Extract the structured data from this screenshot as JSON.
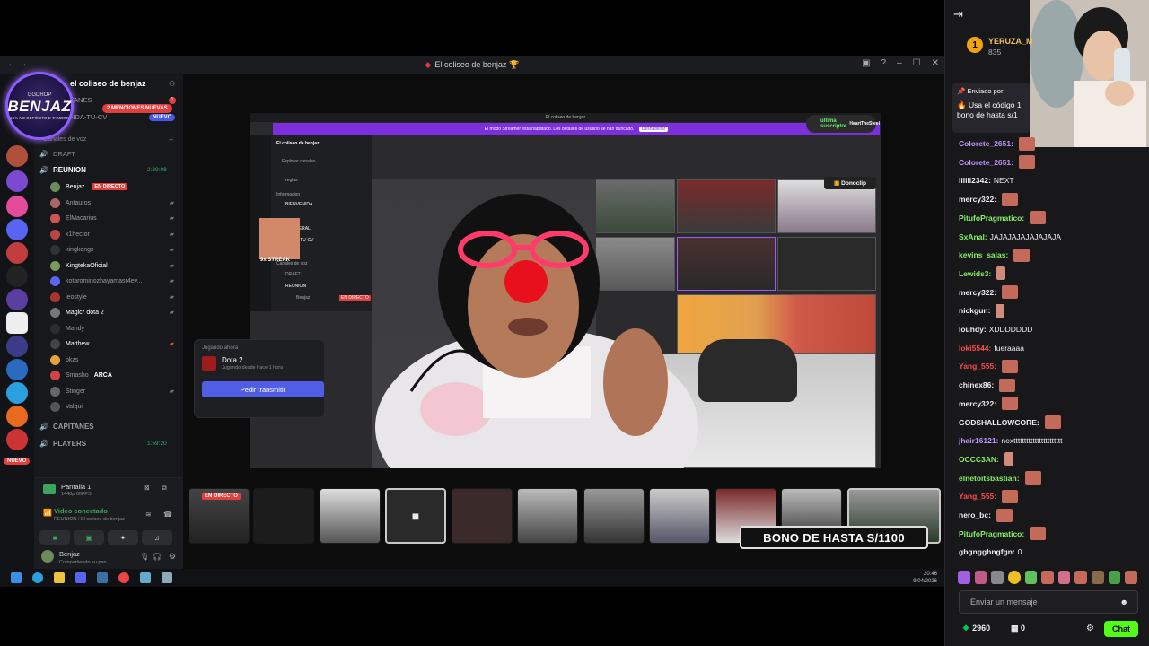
{
  "window": {
    "title": "El coliseo de benjaz",
    "title_emoji": "🏆"
  },
  "logo": {
    "brand": "GGDROP",
    "name": "BENJAZ",
    "tagline": "15% NO DEPÓSITO E TAMBOR"
  },
  "server": {
    "name": "el coliseo de benjaz",
    "mentions_pill": "2 MENCIONES NUEVAS",
    "category_voice": "Canales de voz",
    "tag_nuevo": "NUEVO",
    "channels": [
      {
        "label": "TANES",
        "icon": "hash"
      },
      {
        "label": "NDA-TU-CV",
        "icon": "hash"
      }
    ],
    "voice_channels": [
      {
        "label": "DRAFT",
        "time": ""
      },
      {
        "label": "REUNION",
        "time": "2:39:08"
      }
    ],
    "members": [
      {
        "name": "Benjaz",
        "live": "EN DIRECTO"
      },
      {
        "name": "Antauros"
      },
      {
        "name": "ElMacarius"
      },
      {
        "name": "k1hector"
      },
      {
        "name": "kingkongx"
      },
      {
        "name": "KingtekaOficial"
      },
      {
        "name": "kotarominozhayamasr4ev..."
      },
      {
        "name": "leostyle"
      },
      {
        "name": "Magic* dota 2"
      },
      {
        "name": "Mandy"
      },
      {
        "name": "Matthew"
      },
      {
        "name": "pkzs"
      },
      {
        "name": "Smasho",
        "suffix": "ARCA"
      },
      {
        "name": "Stinger"
      },
      {
        "name": "Valqui"
      }
    ],
    "voice_channels_2": [
      {
        "label": "CAPITANES",
        "time": ""
      },
      {
        "label": "PLAYERS",
        "time": "1:59:20"
      }
    ]
  },
  "voice_panel": {
    "screen_title": "Pantalla 1",
    "screen_sub": "1440p 60FPS",
    "status": "Video conectado",
    "status_sub": "REUNION / El coliseo de benjaz",
    "user": "Benjaz",
    "user_sub": "Compartiendo su pan..."
  },
  "activity_card": {
    "label": "Jugando ahora",
    "game": "Dota 2",
    "since": "Jugando desde hace 1 hora",
    "button": "Pedir transmitir"
  },
  "stream": {
    "topbar": "El coliseo de benjaz",
    "banner": "El modo Streamer está habilitado. Los detalles de usuario se han truncado.",
    "banner_button": "Deshabilitar",
    "mini_server": "El coliseo de benjaz",
    "mini_items": [
      "Explorar canales",
      "reglas",
      "Informacion",
      "BIENVENIDA",
      "GENERAL",
      "NDA-TU-CV",
      "Canales de voz",
      "DRAFT",
      "REUNION",
      "Benjaz"
    ],
    "mini_live": "EN DIRECTO",
    "streak": "9x STREAK",
    "sub_alert": "ultima suscriptor",
    "sub_alert_user": "HeartTheSteel",
    "donoclip": "Donoclip",
    "thumb_live": "EN DIRECTO",
    "bono": "BONO DE HASTA S/1100"
  },
  "taskbar": {
    "time": "20:46",
    "date": "9/04/2026"
  },
  "chat": {
    "gift": {
      "rank": "1",
      "user": "YERUZA_M",
      "count": "835"
    },
    "pinned": {
      "sent_by": "Enviado por",
      "line1": "Usa el código 1",
      "line2": "bono de hasta s/1"
    },
    "messages": [
      {
        "user": "Colorete_2651:",
        "color": "#bf94ff",
        "text": "",
        "emote": true
      },
      {
        "user": "Colorete_2651:",
        "color": "#bf94ff",
        "text": "",
        "emote": true
      },
      {
        "user": "lilili2342:",
        "color": "#efeff1",
        "text": "NEXT",
        "emote": false
      },
      {
        "user": "mercy322:",
        "color": "#efeff1",
        "text": "",
        "emote": true
      },
      {
        "user": "PitufoPragmatico:",
        "color": "#84f063",
        "text": "",
        "emote": true
      },
      {
        "user": "SxAnal:",
        "color": "#84f063",
        "text": "JAJAJAJAJAJAJAJA",
        "emote": false
      },
      {
        "user": "kevins_salas:",
        "color": "#84f063",
        "text": "",
        "emote": true
      },
      {
        "user": "Lewids3:",
        "color": "#84f063",
        "text": "",
        "emote": "small"
      },
      {
        "user": "mercy322:",
        "color": "#efeff1",
        "text": "",
        "emote": true
      },
      {
        "user": "nickgun:",
        "color": "#efeff1",
        "text": "",
        "emote": "small"
      },
      {
        "user": "louhdy:",
        "color": "#efeff1",
        "text": "XDDDDDDD",
        "emote": false
      },
      {
        "user": "loki5544:",
        "color": "#ff4b4b",
        "text": "fueraaaa",
        "emote": false
      },
      {
        "user": "Yang_555:",
        "color": "#ff4b4b",
        "text": "",
        "emote": true
      },
      {
        "user": "chinex86:",
        "color": "#efeff1",
        "text": "",
        "emote": true
      },
      {
        "user": "mercy322:",
        "color": "#efeff1",
        "text": "",
        "emote": true
      },
      {
        "user": "GODSHALLOWCORE:",
        "color": "#efeff1",
        "text": "",
        "emote": true
      },
      {
        "user": "jhair16121:",
        "color": "#bf94ff",
        "text": "nexttttttttttttttttttttttt",
        "emote": false
      },
      {
        "user": "OCCC3AN:",
        "color": "#84f063",
        "text": "",
        "emote": "small"
      },
      {
        "user": "elnetoitsbastian:",
        "color": "#84f063",
        "text": "",
        "emote": true
      },
      {
        "user": "Yang_555:",
        "color": "#ff4b4b",
        "text": "",
        "emote": true
      },
      {
        "user": "nero_bc:",
        "color": "#efeff1",
        "text": "",
        "emote": true
      },
      {
        "user": "PitufoPragmatico:",
        "color": "#84f063",
        "text": "",
        "emote": true
      },
      {
        "user": "gbgnggbngfgn:",
        "color": "#efeff1",
        "text": "0",
        "emote": false
      }
    ],
    "input_placeholder": "Enviar un mensaje",
    "points": "2960",
    "gifts": "0",
    "chat_button": "Chat"
  }
}
